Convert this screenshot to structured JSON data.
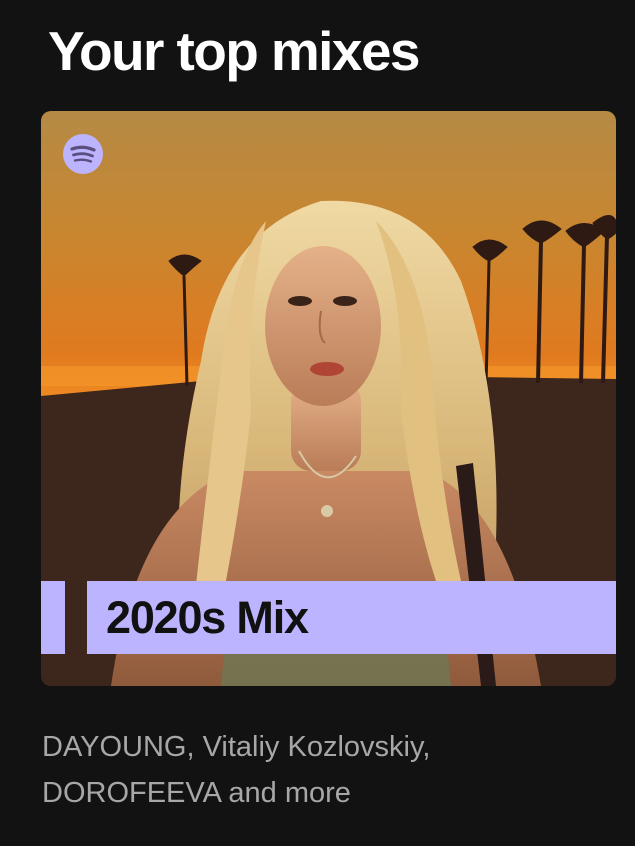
{
  "section": {
    "title": "Your top mixes"
  },
  "mix": {
    "band_title": "2020s Mix",
    "description": "DAYOUNG, Vitaliy Kozlovskiy, DOROFEEVA and more",
    "band_color": "#bcb4ff",
    "logo_icon": "spotify-logo-icon",
    "cover_image": "woman-long-blonde-hair-sunset-palm-trees"
  },
  "colors": {
    "background": "#121212",
    "title": "#ffffff",
    "description": "#a7a7a7",
    "band_text": "#111111"
  }
}
